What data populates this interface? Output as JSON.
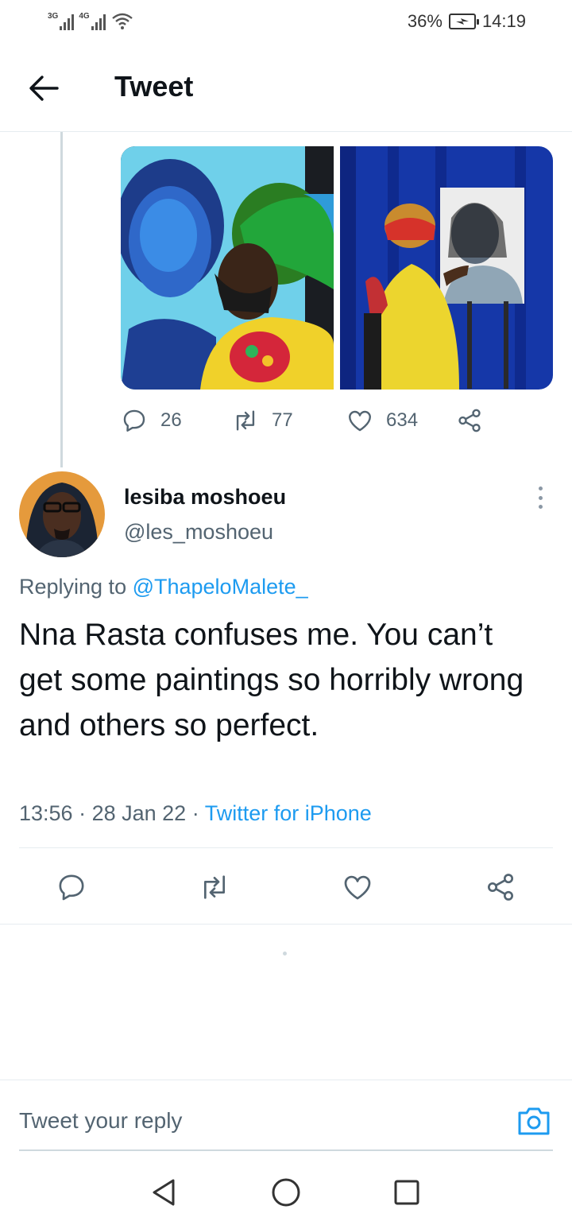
{
  "status_bar": {
    "network1": "3G",
    "network2": "4G",
    "battery": "36%",
    "time": "14:19"
  },
  "header": {
    "title": "Tweet"
  },
  "parent_tweet": {
    "replies": "26",
    "retweets": "77",
    "likes": "634"
  },
  "reply": {
    "author_name": "lesiba moshoeu",
    "author_handle": "@les_moshoeu",
    "replying_prefix": "Replying to ",
    "replying_to": "@ThapeloMalete_",
    "text": "Nna Rasta confuses me. You can’t get some paintings so horribly wrong and others so perfect.",
    "time": "13:56",
    "date": "28 Jan 22",
    "source": "Twitter for iPhone",
    "separator": " · "
  },
  "composer": {
    "placeholder": "Tweet your reply"
  },
  "colors": {
    "accent": "#1d9bf0",
    "secondary_text": "#536471",
    "primary_text": "#0f1419",
    "divider": "#e6ecf0"
  },
  "icons": {
    "back": "arrow-left-icon",
    "reply": "speech-bubble-icon",
    "retweet": "retweet-icon",
    "like": "heart-icon",
    "share": "share-icon",
    "more": "more-vertical-icon",
    "camera": "camera-icon",
    "nav_back": "triangle-back-icon",
    "nav_home": "circle-home-icon",
    "nav_recent": "square-recents-icon"
  }
}
